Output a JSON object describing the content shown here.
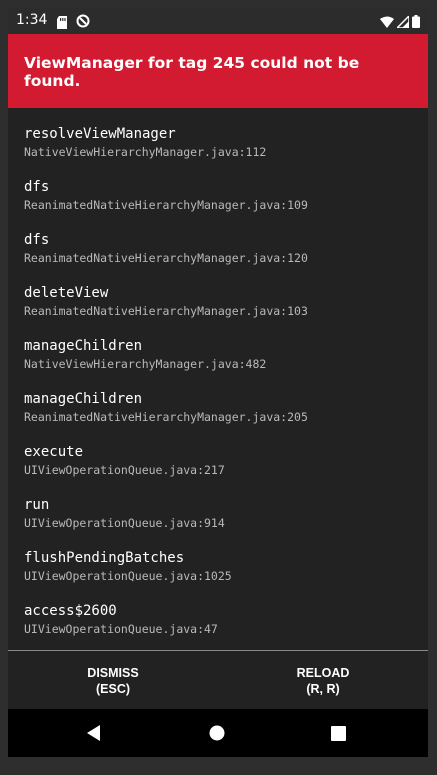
{
  "status_bar": {
    "time": "1:34",
    "icons": [
      "sd-card-icon",
      "sync-icon",
      "wifi-icon",
      "signal-icon",
      "battery-icon"
    ]
  },
  "error": {
    "message": "ViewManager for tag 245 could not be found.",
    "banner_color": "#d21b30"
  },
  "stack": [
    {
      "method": "resolveViewManager",
      "file": "NativeViewHierarchyManager.java:112"
    },
    {
      "method": "dfs",
      "file": "ReanimatedNativeHierarchyManager.java:109"
    },
    {
      "method": "dfs",
      "file": "ReanimatedNativeHierarchyManager.java:120"
    },
    {
      "method": "deleteView",
      "file": "ReanimatedNativeHierarchyManager.java:103"
    },
    {
      "method": "manageChildren",
      "file": "NativeViewHierarchyManager.java:482"
    },
    {
      "method": "manageChildren",
      "file": "ReanimatedNativeHierarchyManager.java:205"
    },
    {
      "method": "execute",
      "file": "UIViewOperationQueue.java:217"
    },
    {
      "method": "run",
      "file": "UIViewOperationQueue.java:914"
    },
    {
      "method": "flushPendingBatches",
      "file": "UIViewOperationQueue.java:1025"
    },
    {
      "method": "access$2600",
      "file": "UIViewOperationQueue.java:47"
    }
  ],
  "buttons": {
    "dismiss": {
      "label": "DISMISS",
      "shortcut": "(ESC)"
    },
    "reload": {
      "label": "RELOAD",
      "shortcut": "(R, R)"
    }
  },
  "nav": {
    "icons": [
      "back-icon",
      "home-icon",
      "recents-icon"
    ]
  }
}
